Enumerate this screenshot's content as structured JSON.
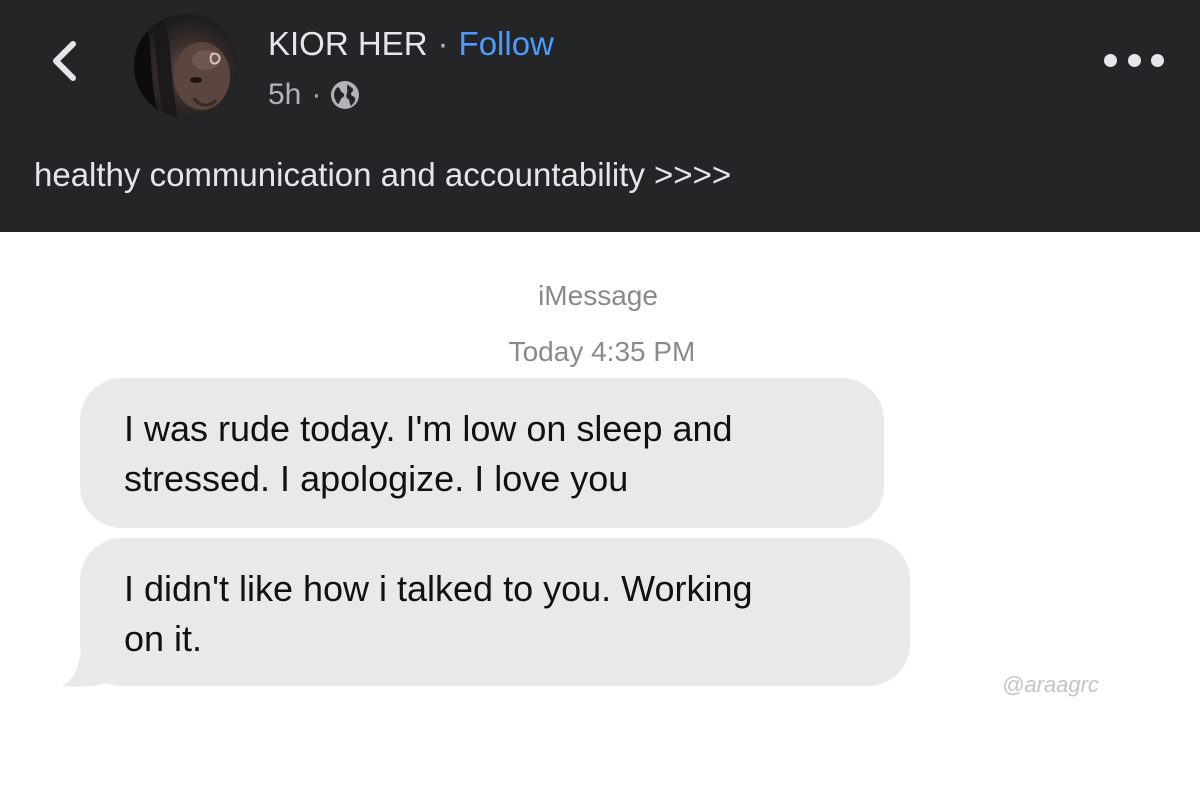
{
  "post": {
    "author": "KIOR HER",
    "separator": "·",
    "follow_label": "Follow",
    "time": "5h",
    "meta_separator": "·",
    "privacy_icon": "globe-icon",
    "caption": "healthy communication and accountability >>>>"
  },
  "screenshot": {
    "service": "iMessage",
    "timestamp": "Today 4:35 PM",
    "messages": [
      {
        "line1": "I was rude today. I'm low on sleep and",
        "line2": "stressed. I apologize. I love you"
      },
      {
        "line1": "I didn't like how i talked to you. Working",
        "line2": "on it."
      }
    ],
    "watermark": "@araagrc"
  },
  "colors": {
    "header_bg": "#242526",
    "follow": "#4e9bff",
    "bubble_bg": "#e9e9eb"
  }
}
